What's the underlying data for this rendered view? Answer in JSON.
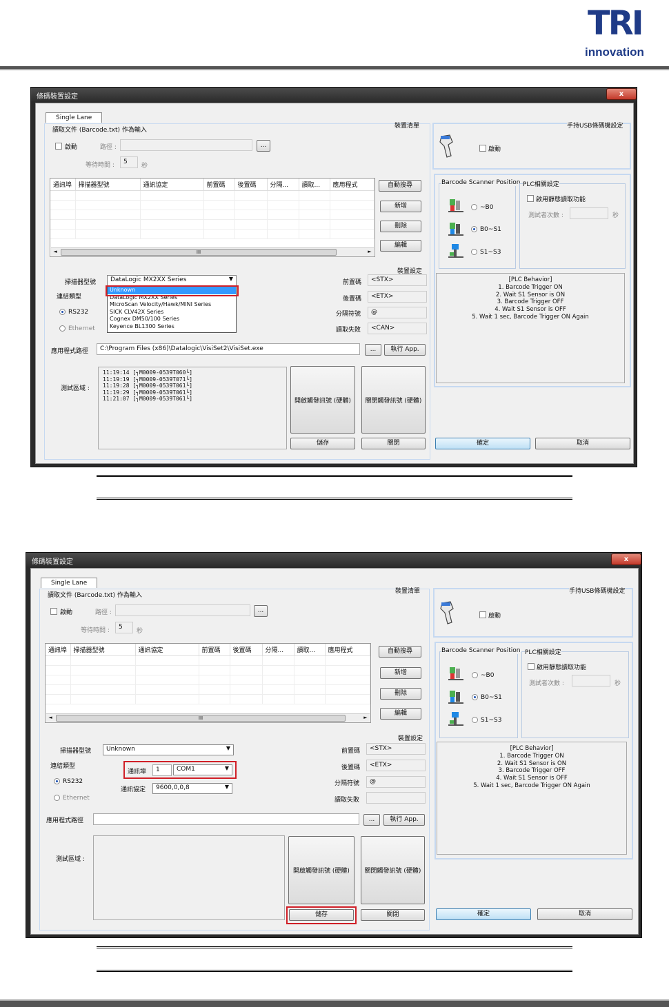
{
  "logo": {
    "main": "TRI",
    "sub": "innovation"
  },
  "dialog": {
    "title": "條碼裝置設定",
    "close": "x",
    "tab": "Single Lane",
    "read_file_group": "讀取文件 (Barcode.txt) 作為輸入",
    "enable": "啟動",
    "path_label": "路徑 :",
    "browse": "...",
    "wait_label": "等待時間 :",
    "wait_value": "5",
    "wait_unit": "秒",
    "device_list_label": "裝置清單",
    "columns": [
      "通訊埠",
      "掃描器型號",
      "通訊協定",
      "前置碼",
      "後置碼",
      "分隔...",
      "讀取...",
      "應用程式"
    ],
    "btn_auto": "自動搜尋",
    "btn_add": "新增",
    "btn_delete": "刪除",
    "btn_edit": "編輯",
    "scroll_mark": "III",
    "device_settings_label": "裝置設定",
    "scanner_model_label": "掃描器型號",
    "conn_type_label": "連結類型",
    "rs232": "RS232",
    "ethernet": "Ethernet",
    "prefix_label": "前置碼",
    "suffix_label": "後置碼",
    "separator_label": "分隔符號",
    "read_fail_label": "讀取失敗",
    "app_path_label": "應用程式路徑",
    "run_app": "執行 App.",
    "test_area_label": "測試區域 :",
    "btn_open_trigger": "開啟觸發訊號 (硬體)",
    "btn_close_trigger": "關閉觸發訊號 (硬體)",
    "btn_save": "儲存",
    "btn_close": "關閉",
    "usb_label": "手持USB條碼機設定",
    "barcode_pos_label": "Barcode Scanner Position",
    "plc_label": "PLC相關設定",
    "plc_enable": "啟用靜態讀取功能",
    "test_count": "測試者次數 :",
    "sec": "秒",
    "pos1": "~B0",
    "pos2": "B0~S1",
    "pos3": "S1~S3",
    "plc_behavior": [
      "[PLC Behavior]",
      "1. Barcode Trigger ON",
      "2. Wait S1 Sensor is ON",
      "3. Barcode Trigger OFF",
      "4. Wait S1 Sensor is OFF",
      "5. Wait 1 sec, Barcode Trigger ON Again"
    ],
    "ok": "確定",
    "cancel": "取消"
  },
  "shot1": {
    "scanner_model": "DataLogic MX2XX Series",
    "dropdown_options": [
      "Unknown",
      "DataLogic MX2XX Series",
      "MicroScan Velocity/Hawk/MINI Series",
      "SICK CLV42X Series",
      "Cognex DM50/100 Series",
      "Keyence BL1300 Series"
    ],
    "prefix": "<STX>",
    "suffix": "<ETX>",
    "separator": "@",
    "read_fail": "<CAN>",
    "app_path": "C:\\Program Files (x86)\\Datalogic\\VisiSet2\\VisiSet.exe",
    "log": [
      "11:19:14 [┐M0009-0539T060└]",
      "11:19:19 [┐M0009-0539T071└]",
      "11:19:28 [┐M0009-0539T061└]",
      "11:19:29 [┐M0009-0539T061└]",
      "11:21:07 [┐M0009-0539T061└]"
    ]
  },
  "shot2": {
    "scanner_model": "Unknown",
    "port_label": "通訊埠",
    "port_num": "1",
    "port_value": "COM1",
    "protocol_label": "通訊協定",
    "protocol_value": "9600,0,0,8",
    "prefix": "<STX>",
    "suffix": "<ETX>",
    "separator": "@",
    "read_fail": "",
    "app_path": ""
  },
  "colors": {
    "brand": "#1f3b87",
    "highlight": "#d01f27",
    "selection": "#3399ff"
  }
}
